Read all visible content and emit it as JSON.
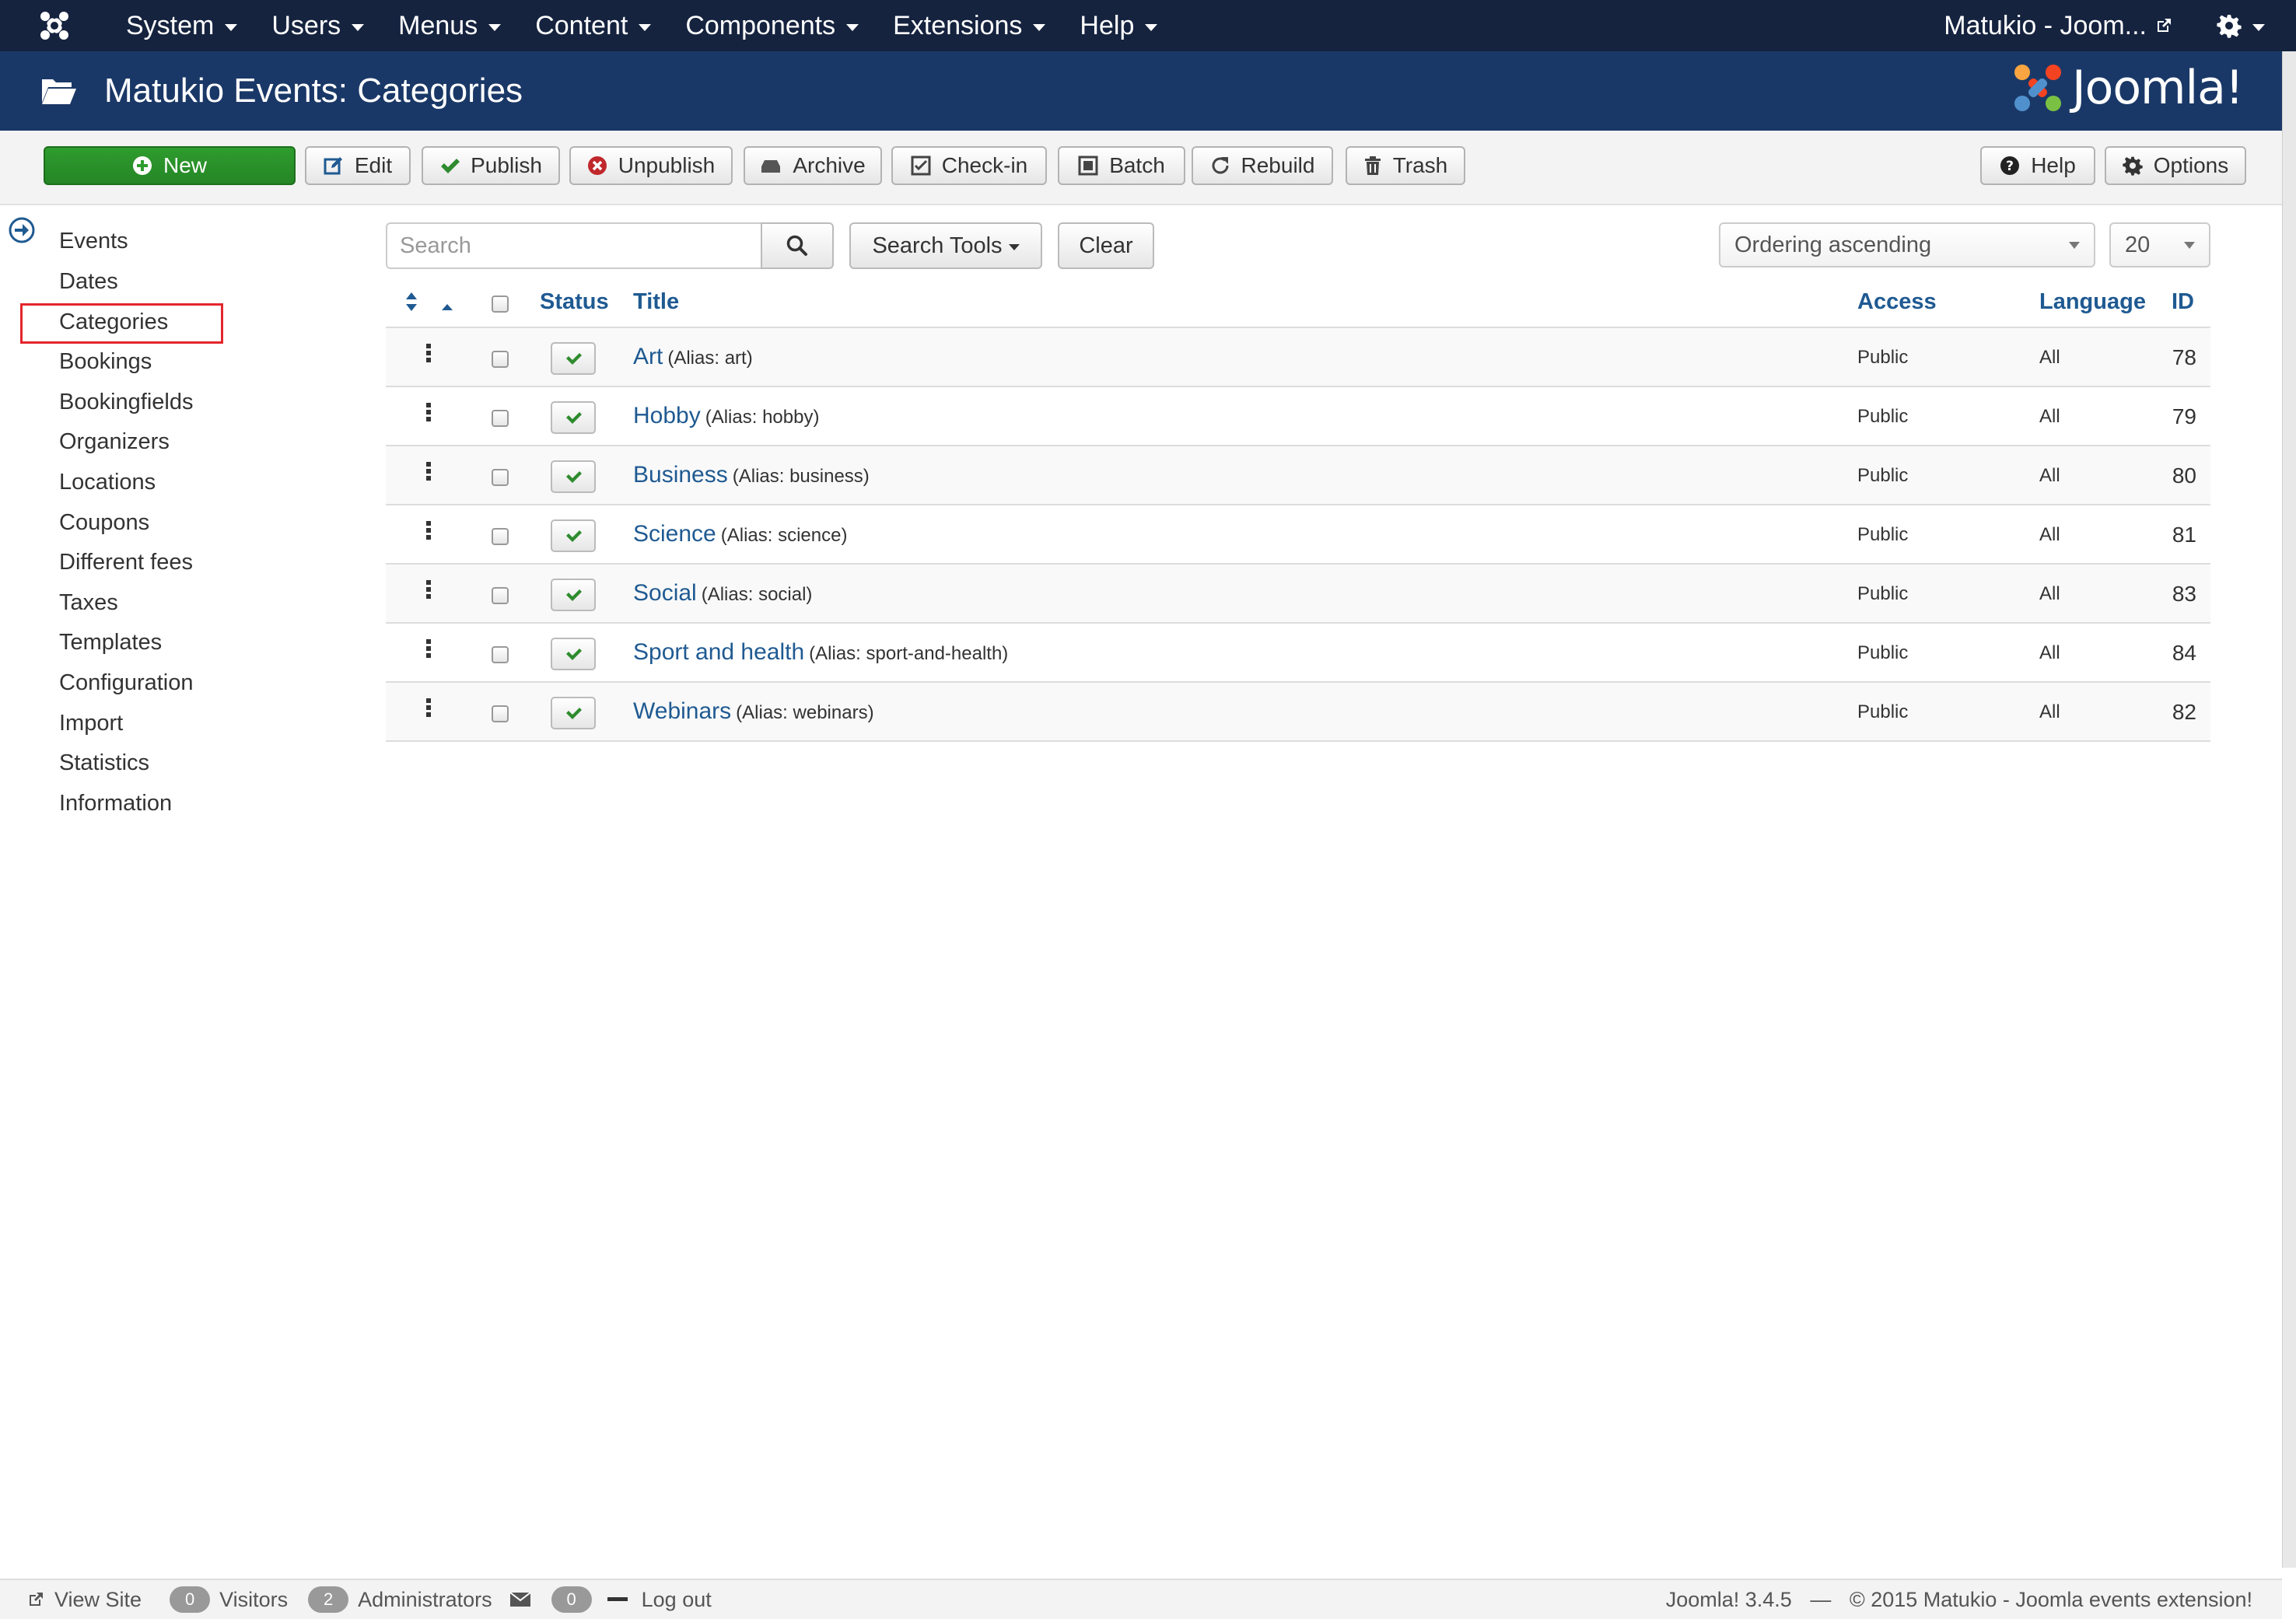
{
  "navbar": {
    "menu": [
      "System",
      "Users",
      "Menus",
      "Content",
      "Components",
      "Extensions",
      "Help"
    ],
    "site_name": "Matukio - Joom..."
  },
  "header": {
    "title": "Matukio Events: Categories",
    "logo_text": "Joomla!"
  },
  "toolbar": {
    "new": "New",
    "edit": "Edit",
    "publish": "Publish",
    "unpublish": "Unpublish",
    "archive": "Archive",
    "checkin": "Check-in",
    "batch": "Batch",
    "rebuild": "Rebuild",
    "trash": "Trash",
    "help": "Help",
    "options": "Options"
  },
  "sidebar": {
    "items": [
      "Events",
      "Dates",
      "Categories",
      "Bookings",
      "Bookingfields",
      "Organizers",
      "Locations",
      "Coupons",
      "Different fees",
      "Taxes",
      "Templates",
      "Configuration",
      "Import",
      "Statistics",
      "Information"
    ],
    "active": "Categories"
  },
  "filters": {
    "search_placeholder": "Search",
    "search_tools": "Search Tools",
    "clear": "Clear",
    "ordering": "Ordering ascending",
    "limit": "20"
  },
  "table": {
    "headers": {
      "status": "Status",
      "title": "Title",
      "access": "Access",
      "language": "Language",
      "id": "ID"
    },
    "rows": [
      {
        "title": "Art",
        "alias": "(Alias: art)",
        "access": "Public",
        "language": "All",
        "id": "78"
      },
      {
        "title": "Hobby",
        "alias": "(Alias: hobby)",
        "access": "Public",
        "language": "All",
        "id": "79"
      },
      {
        "title": "Business",
        "alias": "(Alias: business)",
        "access": "Public",
        "language": "All",
        "id": "80"
      },
      {
        "title": "Science",
        "alias": "(Alias: science)",
        "access": "Public",
        "language": "All",
        "id": "81"
      },
      {
        "title": "Social",
        "alias": "(Alias: social)",
        "access": "Public",
        "language": "All",
        "id": "83"
      },
      {
        "title": "Sport and health",
        "alias": "(Alias: sport-and-health)",
        "access": "Public",
        "language": "All",
        "id": "84"
      },
      {
        "title": "Webinars",
        "alias": "(Alias: webinars)",
        "access": "Public",
        "language": "All",
        "id": "82"
      }
    ]
  },
  "footer": {
    "view_site": "View Site",
    "visitors_count": "0",
    "visitors": "Visitors",
    "admins_count": "2",
    "admins": "Administrators",
    "messages_count": "0",
    "logout": "Log out",
    "version": "Joomla! 3.4.5",
    "separator": "—",
    "copyright": "© 2015 Matukio - Joomla events extension!"
  },
  "colors": {
    "navbar": "#15233f",
    "header": "#1a3867",
    "link": "#1f5a92",
    "new_button": "#2e9c2e",
    "active_outline": "#e3262c"
  }
}
